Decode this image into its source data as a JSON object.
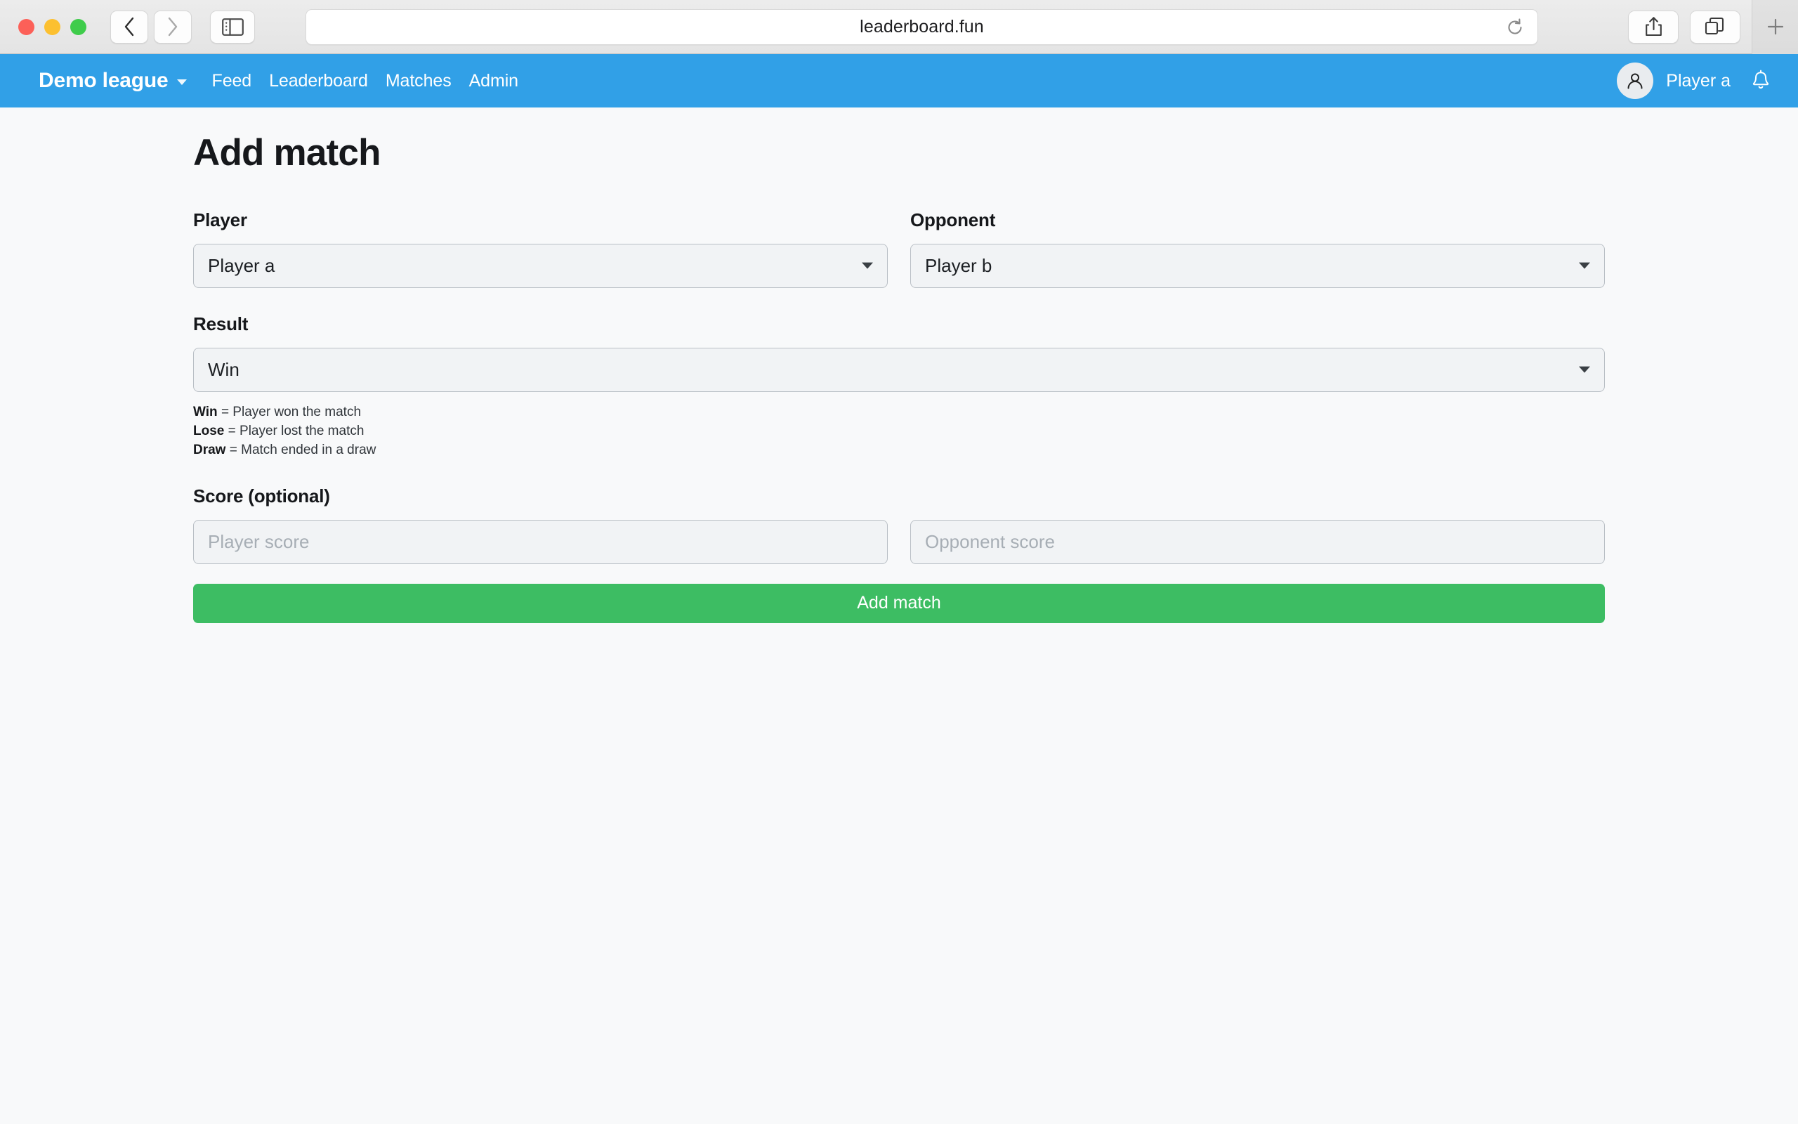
{
  "browser": {
    "url": "leaderboard.fun",
    "controls": {
      "close": "close-window",
      "minimize": "minimize-window",
      "maximize": "maximize-window",
      "back": "back-button",
      "forward": "forward-button",
      "sidebar": "sidebar-toggle",
      "reload": "reload-button",
      "share": "share-button",
      "tabs": "tab-overview-button",
      "new_tab": "new-tab-button"
    }
  },
  "appnav": {
    "brand": "Demo league",
    "links": [
      {
        "label": "Feed"
      },
      {
        "label": "Leaderboard"
      },
      {
        "label": "Matches"
      },
      {
        "label": "Admin"
      }
    ],
    "user": "Player a",
    "accent_color": "#31a0e7"
  },
  "main": {
    "title": "Add match",
    "player": {
      "label": "Player",
      "value": "Player a"
    },
    "opponent": {
      "label": "Opponent",
      "value": "Player b"
    },
    "result": {
      "label": "Result",
      "value": "Win",
      "legend": [
        {
          "term": "Win",
          "desc": "= Player won the match"
        },
        {
          "term": "Lose",
          "desc": "= Player lost the match"
        },
        {
          "term": "Draw",
          "desc": "= Match ended in a draw"
        }
      ]
    },
    "score": {
      "label": "Score (optional)",
      "player_placeholder": "Player score",
      "player_value": "",
      "opponent_placeholder": "Opponent score",
      "opponent_value": ""
    },
    "submit_label": "Add match",
    "submit_color": "#3dbd63"
  }
}
